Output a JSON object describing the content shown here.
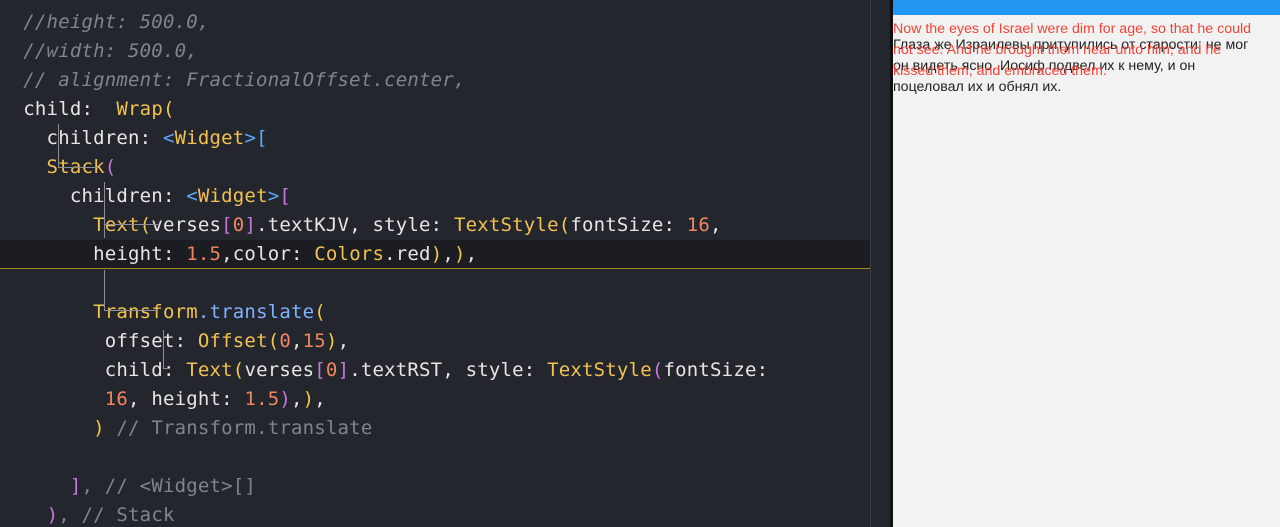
{
  "editor": {
    "lines": [
      [
        {
          "t": "  //height: 500.0,",
          "c": "t-comment"
        }
      ],
      [
        {
          "t": "  //width: 500.0,",
          "c": "t-comment"
        }
      ],
      [
        {
          "t": "  // alignment: FractionalOffset.center,",
          "c": "t-comment"
        }
      ],
      [
        {
          "t": "  child: ",
          "c": "t-prop"
        },
        {
          "t": " Wrap",
          "c": "t-class"
        },
        {
          "t": "(",
          "c": "t-br1"
        }
      ],
      [
        {
          "t": "    children: ",
          "c": "t-prop"
        },
        {
          "t": "<",
          "c": "t-br3"
        },
        {
          "t": "Widget",
          "c": "t-gen"
        },
        {
          "t": ">",
          "c": "t-br3"
        },
        {
          "t": "[",
          "c": "t-br3"
        }
      ],
      [
        {
          "t": "    Stack",
          "c": "t-class"
        },
        {
          "t": "(",
          "c": "t-br2"
        }
      ],
      [
        {
          "t": "      children: ",
          "c": "t-prop"
        },
        {
          "t": "<",
          "c": "t-br3"
        },
        {
          "t": "Widget",
          "c": "t-gen"
        },
        {
          "t": ">",
          "c": "t-br3"
        },
        {
          "t": "[",
          "c": "t-br2"
        }
      ],
      [
        {
          "t": "        Text",
          "c": "t-class"
        },
        {
          "t": "(",
          "c": "t-br1"
        },
        {
          "t": "verses",
          "c": "t-prop"
        },
        {
          "t": "[",
          "c": "t-br2"
        },
        {
          "t": "0",
          "c": "t-num"
        },
        {
          "t": "]",
          "c": "t-br2"
        },
        {
          "t": ".textKJV, style: ",
          "c": "t-prop"
        },
        {
          "t": "TextStyle",
          "c": "t-class"
        },
        {
          "t": "(",
          "c": "t-br1"
        },
        {
          "t": "fontSize: ",
          "c": "t-prop"
        },
        {
          "t": "16",
          "c": "t-num"
        },
        {
          "t": ",",
          "c": "t-punc"
        }
      ],
      [
        {
          "t": "        height: ",
          "c": "t-prop"
        },
        {
          "t": "1.5",
          "c": "t-num"
        },
        {
          "t": ",color: ",
          "c": "t-prop"
        },
        {
          "t": "Colors",
          "c": "t-class"
        },
        {
          "t": ".red",
          "c": "t-prop"
        },
        {
          "t": ")",
          "c": "t-br1"
        },
        {
          "t": ",",
          "c": "t-punc"
        },
        {
          "t": ")",
          "c": "t-br1"
        },
        {
          "t": ",",
          "c": "t-punc"
        }
      ],
      [
        {
          "t": "",
          "c": "t-prop"
        }
      ],
      [
        {
          "t": "        Transform",
          "c": "t-class"
        },
        {
          "t": ".translate",
          "c": "t-fn"
        },
        {
          "t": "(",
          "c": "t-br1"
        }
      ],
      [
        {
          "t": "         offset: ",
          "c": "t-prop"
        },
        {
          "t": "Offset",
          "c": "t-class"
        },
        {
          "t": "(",
          "c": "t-br1"
        },
        {
          "t": "0",
          "c": "t-num"
        },
        {
          "t": ",",
          "c": "t-punc"
        },
        {
          "t": "15",
          "c": "t-num"
        },
        {
          "t": ")",
          "c": "t-br1"
        },
        {
          "t": ",",
          "c": "t-punc"
        }
      ],
      [
        {
          "t": "         child: ",
          "c": "t-prop"
        },
        {
          "t": "Text",
          "c": "t-class"
        },
        {
          "t": "(",
          "c": "t-br1"
        },
        {
          "t": "verses",
          "c": "t-prop"
        },
        {
          "t": "[",
          "c": "t-br2"
        },
        {
          "t": "0",
          "c": "t-num"
        },
        {
          "t": "]",
          "c": "t-br2"
        },
        {
          "t": ".textRST, style: ",
          "c": "t-prop"
        },
        {
          "t": "TextStyle",
          "c": "t-class"
        },
        {
          "t": "(",
          "c": "t-br2"
        },
        {
          "t": "fontSize:",
          "c": "t-prop"
        }
      ],
      [
        {
          "t": "         ",
          "c": "t-prop"
        },
        {
          "t": "16",
          "c": "t-num"
        },
        {
          "t": ", height: ",
          "c": "t-prop"
        },
        {
          "t": "1.5",
          "c": "t-num"
        },
        {
          "t": ")",
          "c": "t-br2"
        },
        {
          "t": ",",
          "c": "t-punc"
        },
        {
          "t": ")",
          "c": "t-br1"
        },
        {
          "t": ",",
          "c": "t-punc"
        }
      ],
      [
        {
          "t": "        ",
          "c": "t-prop"
        },
        {
          "t": ")",
          "c": "t-br1"
        },
        {
          "t": " // Transform.translate",
          "c": "t-comment2"
        }
      ],
      [
        {
          "t": "",
          "c": "t-prop"
        }
      ],
      [
        {
          "t": "      ",
          "c": "t-prop"
        },
        {
          "t": "]",
          "c": "t-br2"
        },
        {
          "t": ", // <Widget>[]",
          "c": "t-comment2"
        }
      ],
      [
        {
          "t": "    ",
          "c": "t-prop"
        },
        {
          "t": ")",
          "c": "t-br2"
        },
        {
          "t": ", // Stack",
          "c": "t-comment2"
        }
      ]
    ]
  },
  "app": {
    "kjv_text": "Now the eyes of Israel were dim for age, so that he could\nnot see. And he brought them near unto him; and he\nkissed them, and embraced them.",
    "rst_text": "Глаза же Израилевы притупились от старости; не мог\nон видеть ясно. Иосиф подвел их к нему, и он\nпоцеловал их и обнял их."
  },
  "colors": {
    "appbar": "#2196f3",
    "kjv": "#f44336",
    "rst": "#222222",
    "editor_bg": "#24262e"
  }
}
